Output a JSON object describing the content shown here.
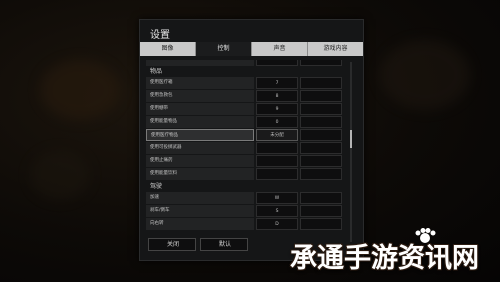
{
  "window": {
    "title": "设置"
  },
  "tabs": [
    {
      "label": "图像",
      "active": false
    },
    {
      "label": "控制",
      "active": true
    },
    {
      "label": "声音",
      "active": false
    },
    {
      "label": "游戏内容",
      "active": false
    }
  ],
  "sections": [
    {
      "heading": "",
      "rows": [
        {
          "label": "",
          "key1": "",
          "key2": "",
          "highlight": false
        }
      ]
    },
    {
      "heading": "物品",
      "rows": [
        {
          "label": "使用医疗箱",
          "key1": "7",
          "key2": "",
          "highlight": false
        },
        {
          "label": "使用急救包",
          "key1": "8",
          "key2": "",
          "highlight": false
        },
        {
          "label": "使用绷带",
          "key1": "9",
          "key2": "",
          "highlight": false
        },
        {
          "label": "使用能量物品",
          "key1": "0",
          "key2": "",
          "highlight": false
        },
        {
          "label": "使用医疗物品",
          "key1": "未分配",
          "key2": "",
          "highlight": true
        },
        {
          "label": "使用可投掷武器",
          "key1": "",
          "key2": "",
          "highlight": false
        },
        {
          "label": "使用止痛药",
          "key1": "",
          "key2": "",
          "highlight": false
        },
        {
          "label": "使用能量饮料",
          "key1": "",
          "key2": "",
          "highlight": false
        }
      ]
    },
    {
      "heading": "驾驶",
      "rows": [
        {
          "label": "加速",
          "key1": "W",
          "key2": "",
          "highlight": false
        },
        {
          "label": "刹车/倒车",
          "key1": "S",
          "key2": "",
          "highlight": false
        },
        {
          "label": "向右转",
          "key1": "D",
          "key2": "",
          "highlight": false
        }
      ]
    }
  ],
  "footer": {
    "close_label": "关闭",
    "default_label": "默认"
  },
  "watermark": {
    "text": "承通手游资讯网"
  },
  "colors": {
    "window_bg": "#151617",
    "tab_active": "#1b1c1d",
    "tab_inactive": "#c9c9c9"
  }
}
